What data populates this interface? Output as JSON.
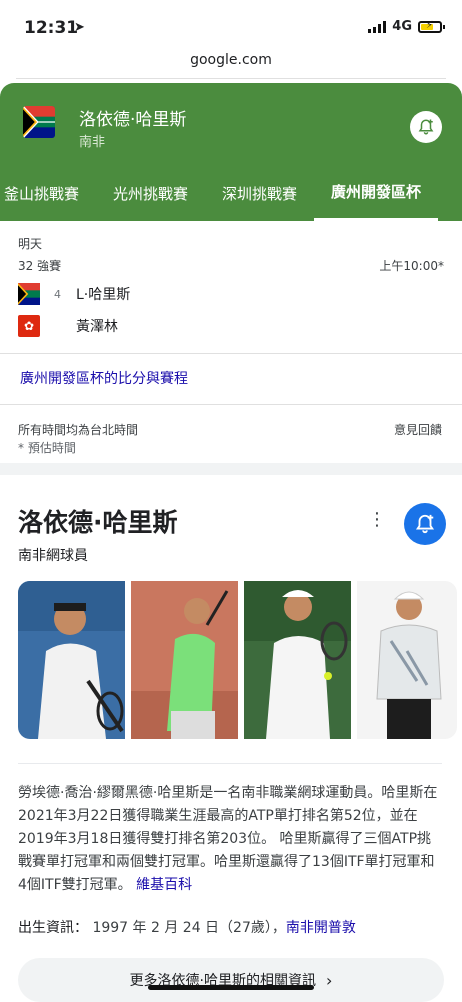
{
  "status_bar": {
    "time": "12:31",
    "network": "4G"
  },
  "browser": {
    "url": "google.com"
  },
  "sports_card": {
    "player_name": "洛依德·哈里斯",
    "country": "南非",
    "tabs": [
      "釜山挑戰賽",
      "光州挑戰賽",
      "深圳挑戰賽",
      "廣州開發區杯"
    ],
    "active_tab": 3,
    "match": {
      "day": "明天",
      "round": "32 強賽",
      "time": "上午10:00*",
      "player1": {
        "seed": "4",
        "name": "L·哈里斯"
      },
      "player2": {
        "name": "黃澤林"
      }
    },
    "link_label": "廣州開發區杯的比分與賽程",
    "timezone_note": "所有時間均為台北時間",
    "estimated_note": "* 預估時間",
    "feedback_label": "意見回饋"
  },
  "knowledge_panel": {
    "title": "洛依德·哈里斯",
    "subtitle": "南非網球員",
    "description": "勞埃德·喬治·繆爾黑德·哈里斯是一名南非職業網球運動員。哈里斯在2021年3月22日獲得職業生涯最高的ATP單打排名第52位，並在2019年3月18日獲得雙打排名第203位。 哈里斯贏得了三個ATP挑戰賽單打冠軍和兩個雙打冠軍。哈里斯還贏得了13個ITF單打冠軍和4個ITF雙打冠軍。",
    "wiki_label": "維基百科",
    "born_label": "出生資訊：",
    "born_value": "1997 年 2 月 24 日（27歲），",
    "born_place": "南非開普敦",
    "more_button": "更多洛依德·哈里斯的相關資訊"
  },
  "colors": {
    "header_green": "#4b8c3e",
    "accent_blue": "#1a73e8",
    "link_blue": "#1a0dab"
  }
}
